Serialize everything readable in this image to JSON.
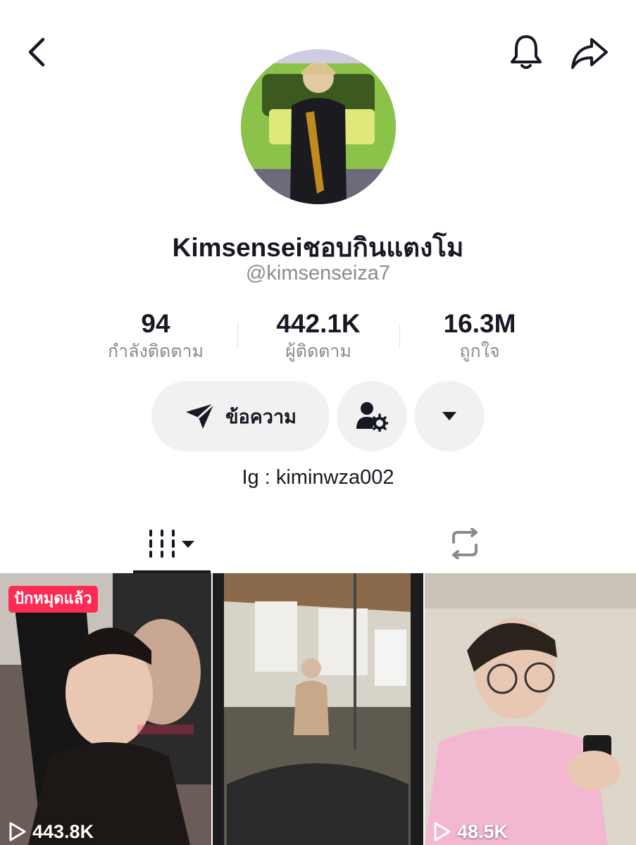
{
  "header": {
    "back_icon": "chevron-left-icon",
    "bell_icon": "bell-icon",
    "share_icon": "share-arrow-icon"
  },
  "profile": {
    "display_name": "Kimsenseiชอบกินแตงโม",
    "username": "@kimsenseiza7",
    "bio": "Ig : kiminwza002"
  },
  "stats": [
    {
      "value": "94",
      "label": "กำลังติดตาม"
    },
    {
      "value": "442.1K",
      "label": "ผู้ติดตาม"
    },
    {
      "value": "16.3M",
      "label": "ถูกใจ"
    }
  ],
  "actions": {
    "message_label": "ข้อความ",
    "message_icon": "send-icon",
    "friends_icon": "user-settings-icon",
    "more_icon": "caret-down-icon"
  },
  "tabs": [
    {
      "name": "videos",
      "icon": "grid-icon",
      "active": true
    },
    {
      "name": "reposts",
      "icon": "repost-icon",
      "active": false
    }
  ],
  "videos": [
    {
      "badge": "ปักหมุดแล้ว",
      "views": "443.8K"
    },
    {
      "badge": "",
      "views": ""
    },
    {
      "badge": "",
      "views": "48.5K"
    }
  ],
  "colors": {
    "accent": "#fe2c55",
    "text_primary": "#161823",
    "text_secondary": "#8a8b91",
    "button_bg": "#f1f1f2"
  }
}
